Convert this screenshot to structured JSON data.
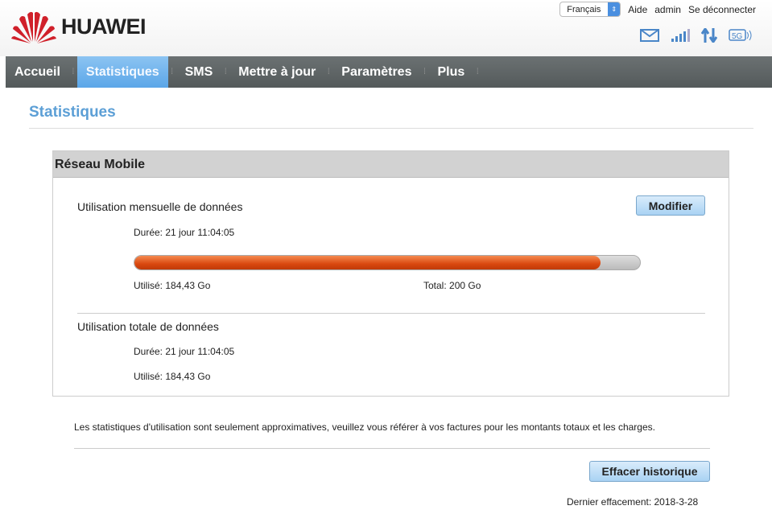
{
  "brand": {
    "name": "HUAWEI"
  },
  "top": {
    "language": "Français",
    "help": "Aide",
    "user": "admin",
    "logout": "Se déconnecter"
  },
  "status_icons": [
    "mail-icon",
    "signal-icon",
    "data-transfer-icon",
    "5g-icon"
  ],
  "nav": [
    {
      "label": "Accueil"
    },
    {
      "label": "Statistiques",
      "active": true
    },
    {
      "label": "SMS"
    },
    {
      "label": "Mettre à jour"
    },
    {
      "label": "Paramètres"
    },
    {
      "label": "Plus"
    }
  ],
  "page": {
    "title": "Statistiques"
  },
  "panel": {
    "title": "Réseau Mobile",
    "monthly": {
      "label": "Utilisation mensuelle de données",
      "duration": "Durée: 21 jour 11:04:05",
      "used": "Utilisé: 184,43 Go",
      "total": "Total: 200 Go",
      "progress_percent": 92.2,
      "edit": "Modifier"
    },
    "total": {
      "label": "Utilisation totale de données",
      "duration": "Durée: 21 jour 11:04:05",
      "used": "Utilisé: 184,43 Go"
    }
  },
  "note": "Les statistiques d'utilisation sont seulement approximatives, veuillez vous référer à vos factures pour les montants totaux et les charges.",
  "clear_button": "Effacer historique",
  "last_clear": "Dernier effacement: 2018-3-28",
  "colors": {
    "accent": "#5c9fd6",
    "progress": "#e0531a",
    "nav": "#5e6465"
  }
}
